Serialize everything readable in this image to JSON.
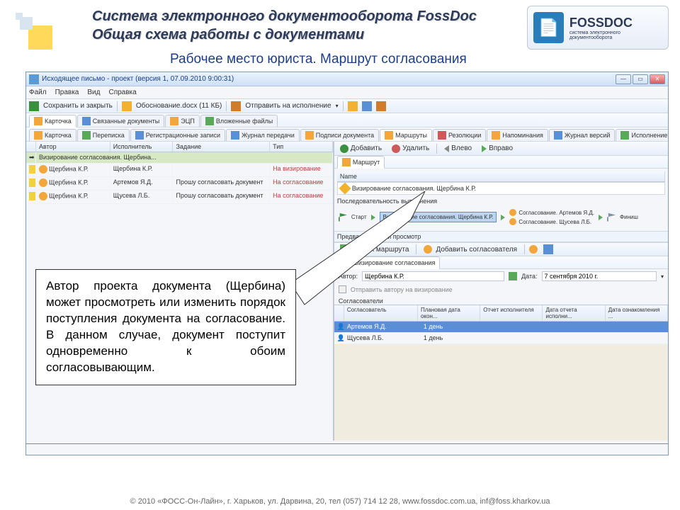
{
  "header": {
    "title1": "Система электронного документооборота FossDoc",
    "title2": "Общая схема работы с документами",
    "logo_text": "FOSSDOC",
    "logo_sub": "система электронного документооборота"
  },
  "subtitle": "Рабочее место юриста. Маршрут согласования",
  "window": {
    "titlebar": "Исходящее письмо - проект (версия 1, 07.09.2010 9:00:31)",
    "menu": [
      "Файл",
      "Правка",
      "Вид",
      "Справка"
    ],
    "toolbar1": {
      "save_close": "Сохранить и закрыть",
      "attachment": "Обоснование.docx (11 КБ)",
      "send": "Отправить на исполнение"
    },
    "tabs_upper": [
      {
        "label": "Карточка"
      },
      {
        "label": "Связанные документы"
      },
      {
        "label": "ЭЦП"
      },
      {
        "label": "Вложенные файлы"
      }
    ],
    "tabs_lower": [
      {
        "label": "Карточка"
      },
      {
        "label": "Переписка"
      },
      {
        "label": "Регистрационные записи"
      },
      {
        "label": "Журнал передачи"
      },
      {
        "label": "Подписи документа"
      },
      {
        "label": "Маршруты"
      },
      {
        "label": "Резолюции"
      },
      {
        "label": "Напоминания"
      },
      {
        "label": "Журнал версий"
      },
      {
        "label": "Исполнение документа"
      }
    ],
    "left_grid": {
      "cols": [
        "Автор",
        "Исполнитель",
        "Задание",
        "Тип"
      ],
      "rows": [
        {
          "author": "Визирование согласования. Щербина...",
          "perf": "",
          "task": "",
          "type": "",
          "highlight": true
        },
        {
          "author": "Щербина К.Р.",
          "perf": "Щербина К.Р.",
          "task": "",
          "type": "На визирование"
        },
        {
          "author": "Щербина К.Р.",
          "perf": "Артемов Я.Д.",
          "task": "Прошу согласовать документ",
          "type": "На согласование"
        },
        {
          "author": "Щербина К.Р.",
          "perf": "Щусева Л.Б.",
          "task": "Прошу согласовать документ",
          "type": "На согласование"
        }
      ]
    },
    "right": {
      "toolbar": {
        "add": "Добавить",
        "del": "Удалить",
        "left": "Влево",
        "right": "Вправо"
      },
      "route_tab": "Маршрут",
      "name_label": "Name",
      "route_name": "Визирование согласования. Щербина К.Р.",
      "seq_label": "Последовательность выполнения",
      "flow": {
        "start": "Старт",
        "node_sel": "Визирование согласования. Щербина К.Р.",
        "node_b": "Согласование. Артемов Я.Д.",
        "node_c": "Согласование. Щусева Л.Б.",
        "finish": "Финиш"
      },
      "preview_label": "Предварительный просмотр",
      "mid_toolbar": {
        "run": "Запуск маршрута",
        "add_approver": "Добавить согласователя"
      },
      "panel_tab": "Визирование согласования",
      "form": {
        "author_label": "Автор:",
        "author_value": "Щербина К.Р.",
        "date_label": "Дата:",
        "date_value": "7 сентября 2010 г.",
        "cb_label": "Отправить автору на визирование",
        "approvers_label": "Согласователи"
      },
      "subgrid": {
        "cols": [
          "Согласователь",
          "Плановая дата окон...",
          "Отчет исполнителя",
          "Дата отчета исполни...",
          "Дата ознакомления ..."
        ],
        "rows": [
          {
            "name": "Артемов Я.Д.",
            "plan": "1 день",
            "sel": true
          },
          {
            "name": "Щусева Л.Б.",
            "plan": "1 день"
          }
        ]
      }
    }
  },
  "callout": "Автор проекта документа (Щербина) может просмотреть или изменить порядок поступления документа на согласование. В данном случае, документ поступит одновременно к обоим согласовывающим.",
  "footer": "© 2010 «ФОСС-Он-Лайн», г. Харьков, ул. Дарвина, 20, тел (057) 714 12 28, www.fossdoc.com.ua, inf@foss.kharkov.ua"
}
